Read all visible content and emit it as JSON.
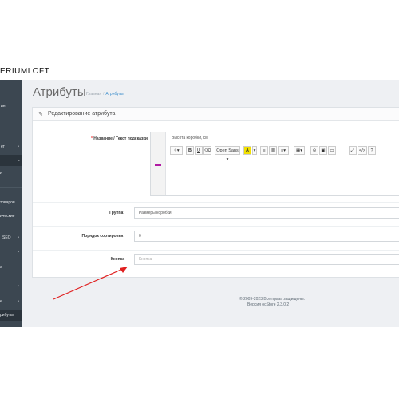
{
  "brand": "ERIUMLOFT",
  "sidebar": {
    "items": [
      {
        "label": "ин",
        "chevron": ""
      },
      {
        "label": "ет",
        "chevron": "›"
      },
      {
        "label": "",
        "chevron": "›"
      },
      {
        "label": "и",
        "chevron": ""
      },
      {
        "label": "товаров",
        "chevron": ""
      },
      {
        "label": "ические",
        "chevron": ""
      },
      {
        "label": "SEO",
        "chevron": "›"
      },
      {
        "label": "",
        "chevron": "›"
      },
      {
        "label": "а",
        "chevron": ""
      },
      {
        "label": "",
        "chevron": "›"
      },
      {
        "label": "е",
        "chevron": "›"
      },
      {
        "label": "рибуты",
        "chevron": ""
      }
    ]
  },
  "header": {
    "title": "Атрибуты",
    "breadcrumb": [
      "Главная",
      "Атрибуты"
    ]
  },
  "panel": {
    "title": "Редактирование атрибута",
    "name_label": "Название / Текст подсказки",
    "name_value": "Высота коробки, см",
    "toolbar": {
      "font": "Open Sans",
      "font_caret": "▾",
      "bold": "B",
      "underline": "U",
      "color_a": "A",
      "list_ul": "≡",
      "list_ol": "≣",
      "align": "≡",
      "table": "▦",
      "link": "⊝",
      "image": "▣",
      "video": "▭",
      "fullscreen": "⤢",
      "code": "</>",
      "help": "?"
    },
    "group_label": "Группа:",
    "group_value": "Размеры коробки",
    "sort_label": "Порядок сортировки:",
    "sort_value": "0",
    "button_label": "Кнопка",
    "button_placeholder": "Кнопка"
  },
  "footer": {
    "copyright": "© 2009-2023 Все права защищены.",
    "version": "Версия ocStore 2.3.0.2"
  },
  "colors": {
    "sidebar": "#3c4751",
    "arrow": "#e02020",
    "flag": "#b01aa3"
  }
}
